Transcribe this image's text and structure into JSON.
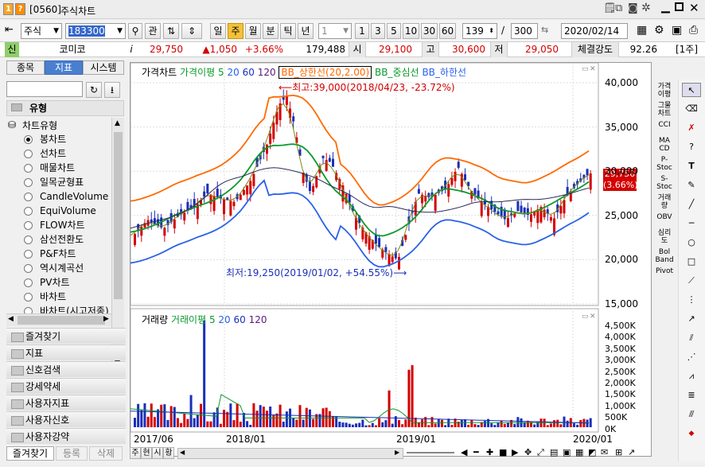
{
  "window": {
    "id": "[0560]",
    "title": "주식차트",
    "icon1": "1",
    "icon2": "?"
  },
  "toolbar": {
    "market": "주식",
    "code": "183300",
    "tagbtn": "관",
    "periods": [
      "일",
      "주",
      "월",
      "분",
      "틱",
      "년"
    ],
    "active_period": "주",
    "unit": "1",
    "nums": [
      "1",
      "3",
      "5",
      "10",
      "30",
      "60"
    ],
    "count": "139",
    "slash": "/",
    "total": "300",
    "date": "2020/02/14"
  },
  "quote": {
    "badge": "신",
    "name": "코미코",
    "info": "i",
    "price": "29,750",
    "change": "▲1,050",
    "rate": "+3.66%",
    "volume": "179,488",
    "open_label": "시",
    "open": "29,100",
    "high_label": "고",
    "high": "30,600",
    "low_label": "저",
    "low": "29,050",
    "strength_label": "체결강도",
    "strength": "92.26",
    "week": "[1주]"
  },
  "left": {
    "tabs": [
      "종목",
      "지표",
      "시스템"
    ],
    "active_tab": "지표",
    "header": "유형",
    "group": "차트유형",
    "items": [
      "봉차트",
      "선차트",
      "매물차트",
      "일목균형표",
      "CandleVolume",
      "EquiVolume",
      "FLOW차트",
      "삼선전환도",
      "P&F차트",
      "역시계곡선",
      "PV차트",
      "바차트",
      "바차트(시고저종)"
    ],
    "selected": "봉차트",
    "folders": [
      "즐겨찾기",
      "지표",
      "신호검색",
      "강세약세",
      "사용자지표",
      "사용자신호",
      "사용자강약"
    ],
    "bottom_tabs": [
      "즐겨찾기",
      "등록",
      "삭제"
    ]
  },
  "chart": {
    "legend": {
      "main": "가격차트",
      "avg": "가격이평",
      "p5": "5",
      "p20": "20",
      "p60": "60",
      "p120": "120",
      "bbu": "BB_상한선(20,2.00)",
      "bbm": "BB_중심선",
      "bbl": "BB_하한선"
    },
    "yticks": [
      "40,000",
      "35,000",
      "30,000",
      "25,000",
      "20,000",
      "15,000"
    ],
    "max_label": "최고:39,000(2018/04/23, -23.72%)",
    "min_label": "최저:19,250(2019/01/02, +54.55%)",
    "price_tag": "29,750",
    "rate_tag": "(3.66%)"
  },
  "volume": {
    "legend": {
      "main": "거래량",
      "avg": "거래이평",
      "p5": "5",
      "p20": "20",
      "p60": "60",
      "p120": "120"
    },
    "yticks": [
      "4,500K",
      "4,000K",
      "3,500K",
      "3,000K",
      "2,500K",
      "2,000K",
      "1,500K",
      "1,000K",
      "500K",
      "0K"
    ]
  },
  "xaxis": [
    "2017/06",
    "2018/01",
    "2019/01",
    "2020/01"
  ],
  "bottom": {
    "buttons": [
      "주",
      "현",
      "시",
      "황"
    ]
  },
  "indicators": [
    "가격\n이평",
    "그물\n차트",
    "CCI",
    "MA\nCD",
    "P-\nStoc",
    "S-\nStoc",
    "거래\n량",
    "OBV",
    "심리\n도",
    "Bol\nBand",
    "Pivot"
  ],
  "colors": {
    "up": "#d40000",
    "down": "#1a2fb8",
    "bb_upper": "#ff6a00",
    "bb_mid": "#0a9a2a",
    "bb_lower": "#2a62e8",
    "ma": "#2a2a5a"
  }
}
